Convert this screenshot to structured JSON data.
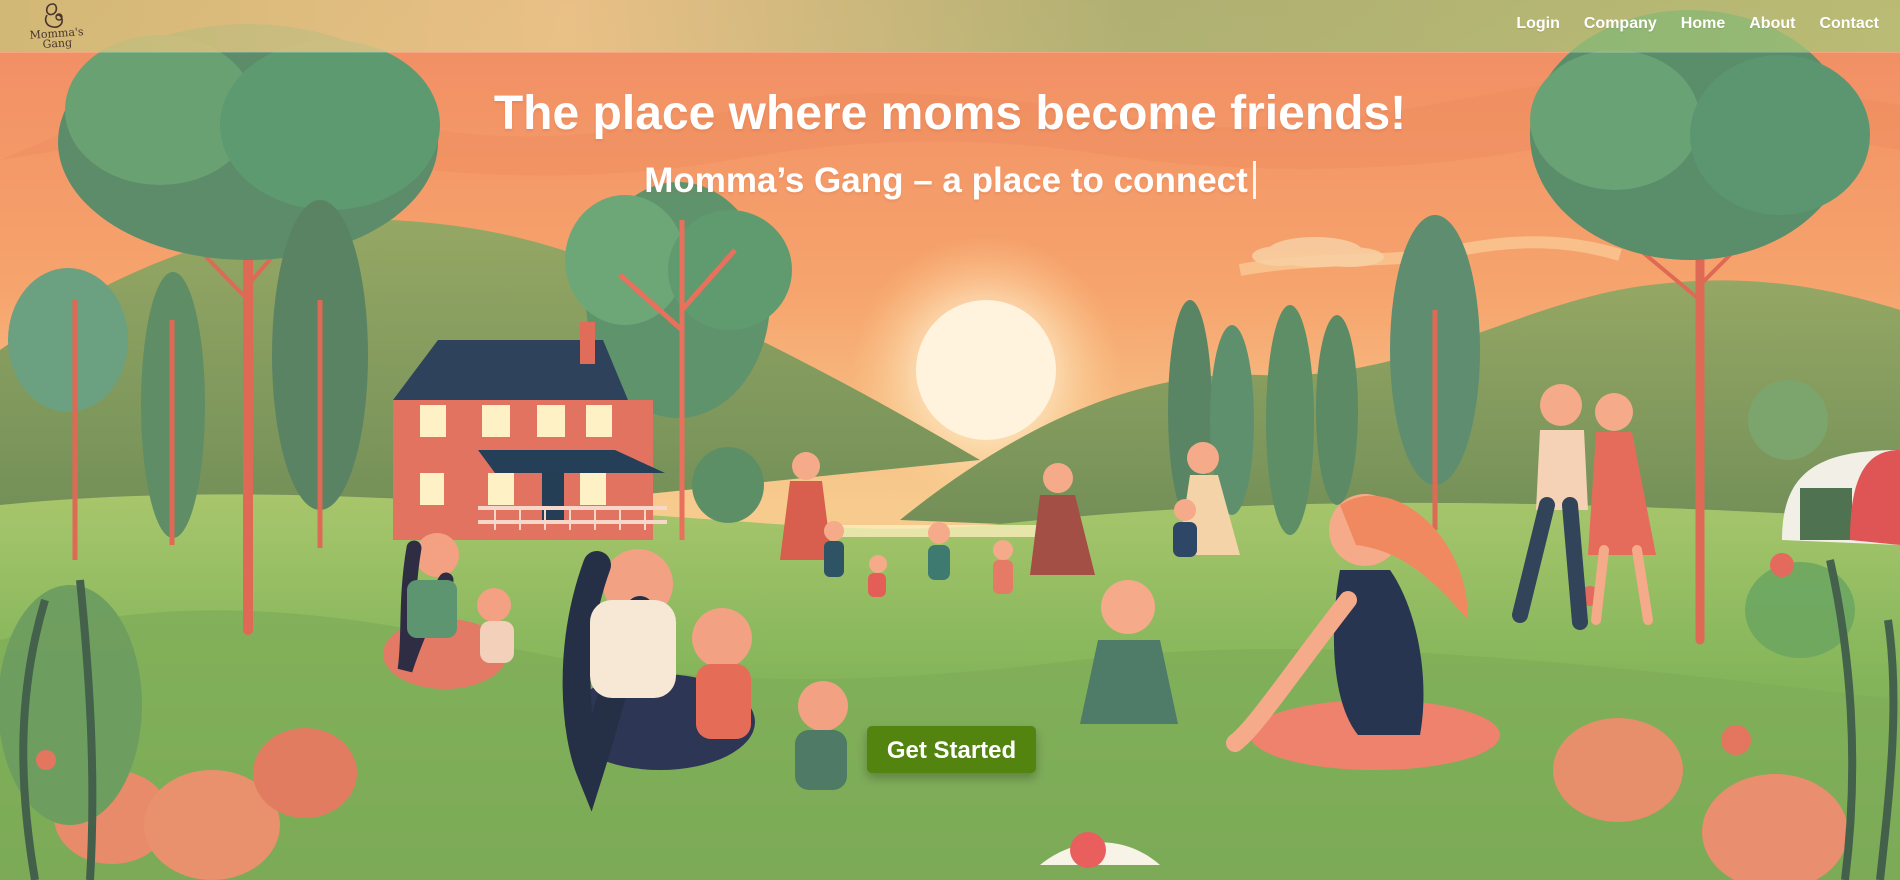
{
  "header": {
    "logo": {
      "lines": [
        "Momma's",
        "Gang"
      ]
    },
    "nav": [
      "Login",
      "Company",
      "Home",
      "About",
      "Contact"
    ]
  },
  "hero": {
    "title": "The place where moms become friends!",
    "subtitle": "Momma’s Gang – a place to connect",
    "cta_label": "Get Started"
  },
  "colors": {
    "sky": "#f6b082",
    "sun": "#fff2d8",
    "grass": "#88b95d",
    "tree": "#5c8f67",
    "button": "#52840f",
    "nav_text": "#ffffff"
  },
  "icons": {
    "logo": "mother-child-icon",
    "cursor": "text-cursor-icon"
  }
}
